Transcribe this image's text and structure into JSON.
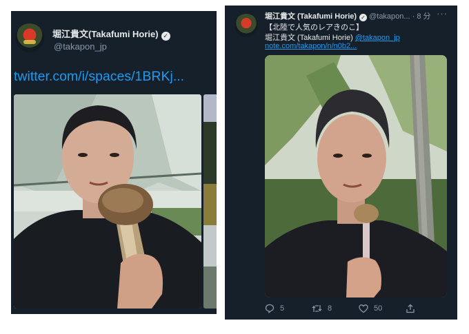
{
  "left": {
    "author_name": "堀江貴文(Takafumi Horie)",
    "handle": "@takapon_jp",
    "link": "twitter.com/i/spaces/1BRKj..."
  },
  "right": {
    "author_name": "堀江貴文 (Takafumi Horie)",
    "handle": "@takapon...",
    "time": "· 8 分",
    "more": "···",
    "title_line": "【北陸で人気のレアきのこ】",
    "author_line": "堀江貴文 (Takafumi Horie)",
    "mention": "@takapon_jp",
    "link": "note.com/takapon/n/n0b2...",
    "replies": "5",
    "retweets": "8",
    "likes": "50"
  },
  "icons": [
    "verified-icon",
    "more-icon",
    "reply-icon",
    "retweet-icon",
    "like-icon",
    "share-icon"
  ],
  "colors": {
    "background": "#15202b",
    "text": "#e7e9ea",
    "muted": "#8b98a5",
    "link": "#1d9bf0"
  }
}
